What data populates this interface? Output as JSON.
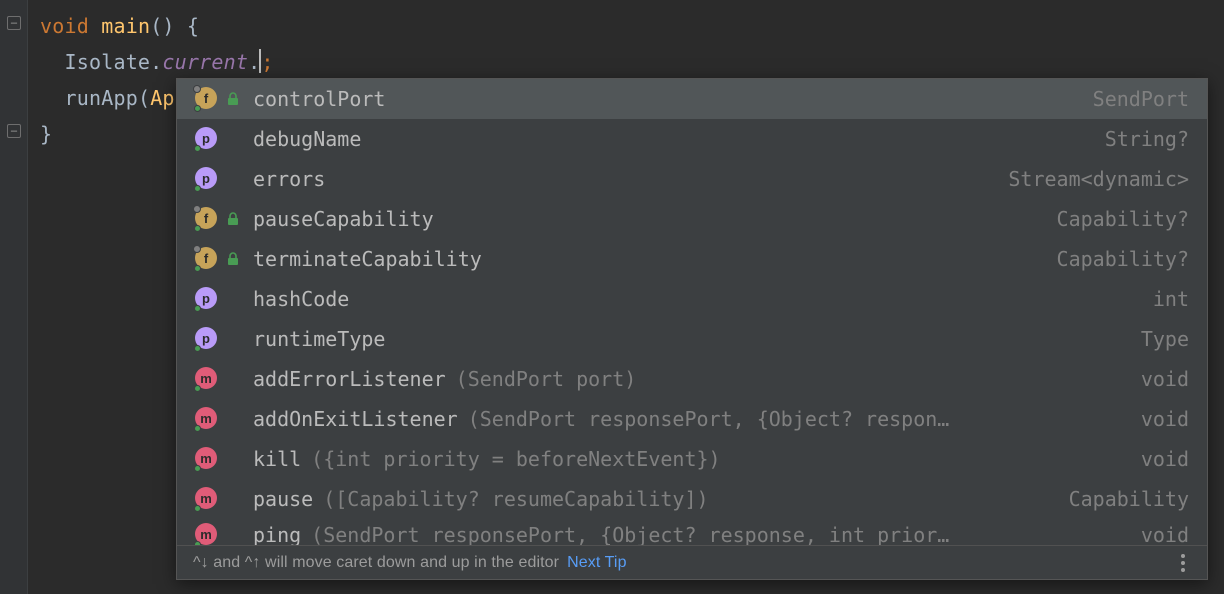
{
  "code": {
    "kw_void": "void",
    "fn_main": "main",
    "paren_open": "()",
    "brace_open": " {",
    "cls_isolate": "Isolate",
    "dot1": ".",
    "prop_current": "current",
    "dot2": ".",
    "semi": ";",
    "fn_runapp": "runApp",
    "paren": "(",
    "cls_app": "App",
    "brace_close": "}"
  },
  "completion": {
    "items": [
      {
        "kind": "f",
        "name": "controlPort",
        "params": "",
        "return": "SendPort",
        "locked": true,
        "selected": true,
        "corner": true
      },
      {
        "kind": "p",
        "name": "debugName",
        "params": "",
        "return": "String?",
        "locked": false,
        "corner": false
      },
      {
        "kind": "p",
        "name": "errors",
        "params": "",
        "return": "Stream<dynamic>",
        "locked": false,
        "corner": false
      },
      {
        "kind": "f",
        "name": "pauseCapability",
        "params": "",
        "return": "Capability?",
        "locked": true,
        "corner": true
      },
      {
        "kind": "f",
        "name": "terminateCapability",
        "params": "",
        "return": "Capability?",
        "locked": true,
        "corner": true
      },
      {
        "kind": "p",
        "name": "hashCode",
        "params": "",
        "return": "int",
        "locked": false,
        "corner": false
      },
      {
        "kind": "p",
        "name": "runtimeType",
        "params": "",
        "return": "Type",
        "locked": false,
        "corner": false
      },
      {
        "kind": "m",
        "name": "addErrorListener",
        "params": "(SendPort port)",
        "return": "void",
        "locked": false,
        "corner": false
      },
      {
        "kind": "m",
        "name": "addOnExitListener",
        "params": "(SendPort responsePort, {Object? respon…",
        "return": "void",
        "locked": false,
        "corner": false
      },
      {
        "kind": "m",
        "name": "kill",
        "params": "({int priority = beforeNextEvent})",
        "return": "void",
        "locked": false,
        "corner": false
      },
      {
        "kind": "m",
        "name": "pause",
        "params": "([Capability? resumeCapability])",
        "return": "Capability",
        "locked": false,
        "corner": false
      },
      {
        "kind": "m",
        "name": "ping",
        "params": "(SendPort responsePort, {Object? response, int prior…",
        "return": "void",
        "locked": false,
        "corner": false
      }
    ],
    "hint_prefix": "^↓ and ^↑ will move caret down and up in the editor",
    "hint_link": "Next Tip"
  }
}
